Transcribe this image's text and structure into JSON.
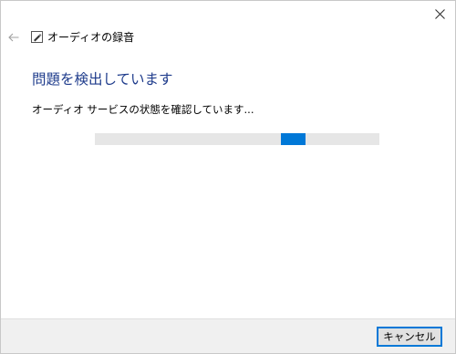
{
  "window": {
    "close_icon": "close-icon",
    "back_icon": "back-arrow-icon"
  },
  "header": {
    "icon": "audio-troubleshooter-icon",
    "title": "オーディオの録音"
  },
  "main": {
    "title": "問題を検出しています",
    "status": "オーディオ サービスの状態を確認しています..."
  },
  "progress": {
    "indeterminate": true,
    "chunk_color": "#0078d7",
    "track_color": "#e6e6e6"
  },
  "footer": {
    "cancel_label": "キャンセル"
  },
  "colors": {
    "title": "#1f3c8c",
    "accent": "#0078d7",
    "footer_bg": "#f0f0f0"
  }
}
